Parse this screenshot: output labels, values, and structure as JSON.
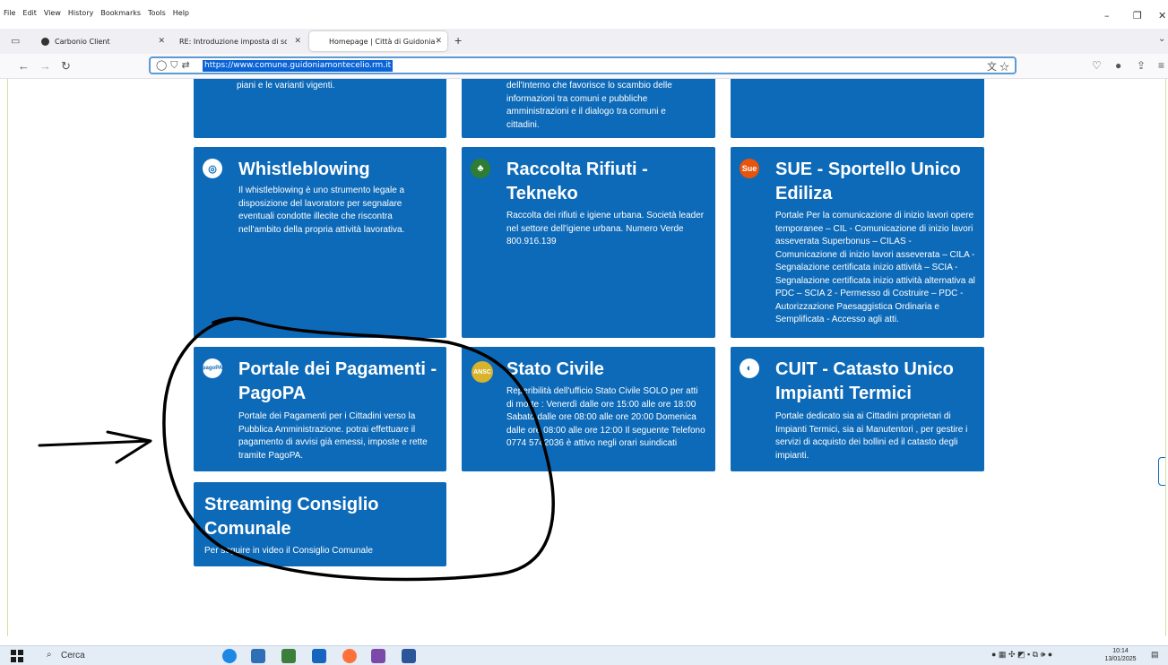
{
  "menubar": {
    "items": [
      "File",
      "Edit",
      "View",
      "History",
      "Bookmarks",
      "Tools",
      "Help"
    ]
  },
  "tabs": [
    {
      "label": "Carbonio Client"
    },
    {
      "label": "RE: Introduzione imposta di soggior"
    },
    {
      "label": "Homepage | Città di Guidonia M"
    }
  ],
  "address_bar": {
    "url": "https://www.comune.guidoniamontecelio.rm.it"
  },
  "cards": {
    "top_left_tail": "piani e le varianti vigenti.",
    "top_mid_tail": "dell'Interno che favorisce lo scambio delle informazioni tra comuni e pubbliche amministrazioni e il dialogo tra comuni e cittadini.",
    "whistleblowing": {
      "title": "Whistleblowing",
      "text": "Il whistleblowing è uno strumento legale a disposizione del lavoratore per segnalare eventuali condotte illecite che riscontra nell'ambito della propria attività lavorativa."
    },
    "rifiuti": {
      "title": "Raccolta Rifiuti - Tekneko",
      "text": "Raccolta dei rifiuti e igiene urbana. Società leader nel settore dell'igiene urbana. Numero Verde 800.916.139"
    },
    "sue": {
      "icon_text": "Sue",
      "title": "SUE - Sportello Unico Ediliza",
      "text": "Portale Per la comunicazione di inizio lavori opere temporanee – CIL - Comunicazione di inizio lavori asseverata Superbonus – CILAS - Comunicazione di inizio lavori asseverata – CILA - Segnalazione certificata inizio attività – SCIA - Segnalazione certificata inizio attività alternativa al PDC – SCIA 2 - Permesso di Costruire – PDC - Autorizzazione Paesaggistica Ordinaria e Semplificata - Accesso agli atti."
    },
    "pagopa": {
      "icon_text": "pagoPA",
      "title": "Portale dei Pagamenti - PagoPA",
      "text": "Portale dei Pagamenti per i Cittadini verso la Pubblica Amministrazione. potrai effettuare il pagamento di avvisi già emessi, imposte e rette tramite PagoPA."
    },
    "stato_civile": {
      "icon_text": "ANSC",
      "title": "Stato Civile",
      "text": "Reperibilità dell'ufficio Stato Civile SOLO per atti di morte : Venerdì dalle ore 15:00 alle ore 18:00 Sabato dalle ore 08:00 alle ore 20:00 Domenica dalle ore 08:00 alle ore 12:00 Il seguente Telefono 0774 5742036 è attivo negli orari suindicati"
    },
    "cuit": {
      "title": "CUIT - Catasto Unico Impianti Termici",
      "text": "Portale dedicato sia ai Cittadini proprietari di Impianti Termici, sia ai Manutentori , per gestire i servizi di acquisto dei bollini ed il catasto degli impianti."
    },
    "streaming": {
      "title": "Streaming Consiglio Comunale",
      "text": "Per seguire in video il Consiglio Comunale"
    }
  },
  "taskbar": {
    "search_label": "Cerca",
    "time": "10:14",
    "date": "13/01/2025"
  },
  "colors": {
    "card_blue": "#0d6ab8",
    "url_highlight": "#0a64d6",
    "annotation_ink": "#000000"
  }
}
